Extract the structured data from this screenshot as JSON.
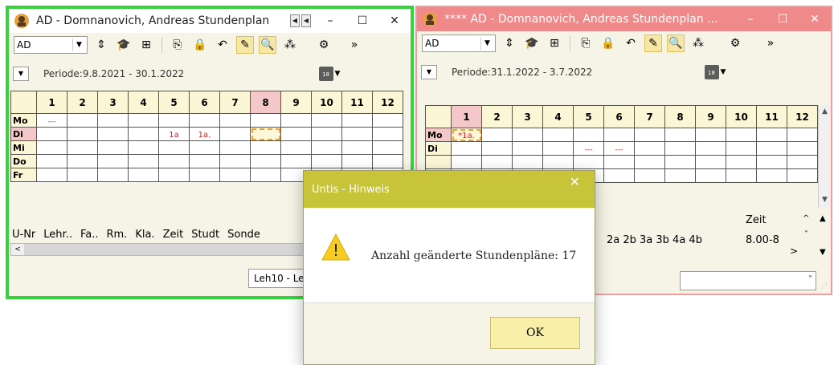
{
  "left_window": {
    "title": "AD - Domnanovich, Andreas  Stundenplan",
    "controls": {
      "minimize": "–",
      "maximize": "☐",
      "close": "✕"
    },
    "combo_value": "AD",
    "period": "Periode:9.8.2021 - 30.1.2022",
    "calendar_label": "18",
    "hours": [
      "1",
      "2",
      "3",
      "4",
      "5",
      "6",
      "7",
      "8",
      "9",
      "10",
      "11",
      "12"
    ],
    "days": [
      "Mo",
      "Di",
      "Mi",
      "Do",
      "Fr"
    ],
    "cells": {
      "mo_1": "---",
      "di_5": "1a",
      "di_6": "1a."
    },
    "bottom_columns": [
      "U-Nr",
      "Lehr..",
      "Fa..",
      "Rm.",
      "Kla.",
      "Zeit",
      "Studt",
      "Sonde"
    ],
    "status": "Leh10 - Le"
  },
  "right_window": {
    "title": "**** AD - Domnanovich, Andreas  Stundenplan  ...",
    "controls": {
      "minimize": "–",
      "maximize": "☐",
      "close": "✕"
    },
    "combo_value": "AD",
    "period": "Periode:31.1.2022 - 3.7.2022",
    "calendar_label": "18",
    "hours": [
      "1",
      "2",
      "3",
      "4",
      "5",
      "6",
      "7",
      "8",
      "9",
      "10",
      "11",
      "12"
    ],
    "days": [
      "Mo",
      "Di"
    ],
    "cells": {
      "mo_1": "*1a.",
      "di_5": "---",
      "di_6": "---"
    },
    "zeit_header": "Zeit",
    "bottom_partial": "2a  2b  3a  3b  4a  4b",
    "zeit_value": "8.00-8"
  },
  "dialog": {
    "title": "Untis - Hinweis",
    "close": "✕",
    "message": "Anzahl geänderte Stundenpläne: 17",
    "ok_label": "OK",
    "warn_glyph": "!"
  },
  "colors": {
    "left_border": "#35d43d",
    "right_border": "#f09c9c",
    "dialog_title": "#c8c439",
    "header_cell": "#fbf6d6",
    "highlight_pink": "#f4c7c9"
  }
}
